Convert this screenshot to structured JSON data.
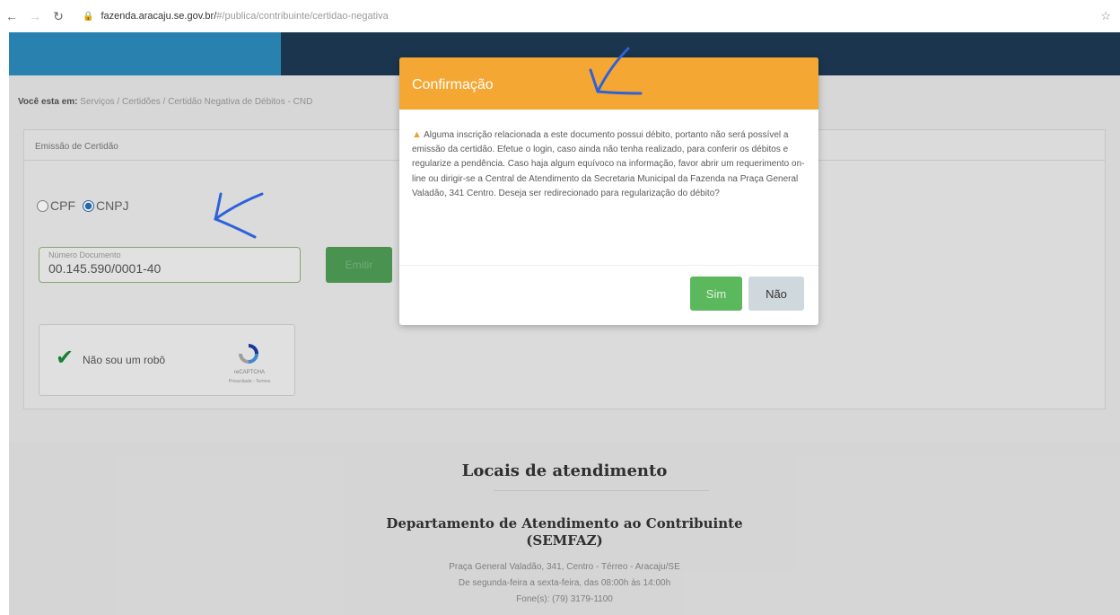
{
  "browser": {
    "url_host": "fazenda.aracaju.se.gov.br/",
    "url_path": "#/publica/contribuinte/certidao-negativa",
    "back_icon": "arrow-left-icon",
    "forward_icon": "arrow-right-icon",
    "reload_icon": "reload-icon",
    "lock_icon": "lock-icon",
    "star_icon": "star-icon"
  },
  "breadcrumb": {
    "prefix": "Você esta em:",
    "path": "Serviços / Certidões / Certidão Negativa de Débitos - CND"
  },
  "form": {
    "panel_title": "Emissão de Certidão",
    "radio_cpf": "CPF",
    "radio_cnpj": "CNPJ",
    "selected": "CNPJ",
    "doc_label": "Número Documento",
    "doc_value": "00.145.590/0001-40",
    "emit_button": "Emitir"
  },
  "captcha": {
    "label": "Não sou um robô",
    "brand": "reCAPTCHA",
    "links": "Privacidade - Termos"
  },
  "locais": {
    "title": "Locais de atendimento",
    "dept_line1": "Departamento de Atendimento ao Contribuinte",
    "dept_line2": "(SEMFAZ)",
    "address": "Praça General Valadão, 341, Centro - Térreo - Aracaju/SE",
    "hours": "De segunda-feira a sexta-feira, das 08:00h às 14:00h",
    "phone": "Fone(s): (79) 3179-1100"
  },
  "modal": {
    "title": "Confirmação",
    "message": "Alguma inscrição relacionada a este documento possui débito, portanto não será possível a emissão da certidão. Efetue o login, caso ainda não tenha realizado, para conferir os débitos e regularize a pendência. Caso haja algum equívoco na informação, favor abrir um requerimento on-line ou dirigir-se a Central de Atendimento da Secretaria Municipal da Fazenda na Praça General Valadão, 341 Centro. Deseja ser redirecionado para regularização do débito?",
    "yes_button": "Sim",
    "no_button": "Não",
    "warning_icon": "warning-icon"
  },
  "colors": {
    "modal_header": "#f5a733",
    "yes_button": "#5cb85c",
    "no_button": "#cfd8dc",
    "site_header": "#1d3a53",
    "header_accent": "#2d8bbd",
    "pen_annotation": "#2f62d8"
  }
}
